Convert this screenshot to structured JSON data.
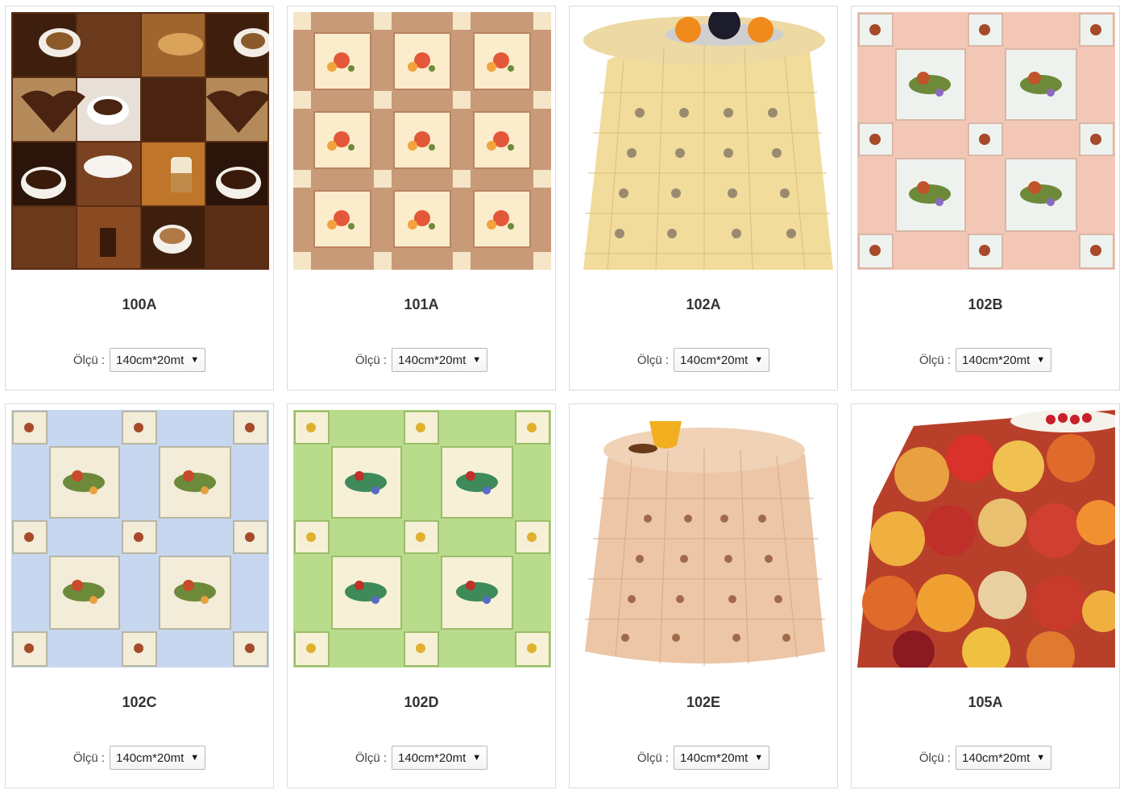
{
  "products": [
    {
      "code": "100A",
      "size_label": "Ölçü :",
      "size_value": "140cm*20mt",
      "pattern": "coffee-collage"
    },
    {
      "code": "101A",
      "size_label": "Ölçü :",
      "size_value": "140cm*20mt",
      "pattern": "floral-beige-grid"
    },
    {
      "code": "102A",
      "size_label": "Ölçü :",
      "size_value": "140cm*20mt",
      "pattern": "round-table-yellow"
    },
    {
      "code": "102B",
      "size_label": "Ölçü :",
      "size_value": "140cm*20mt",
      "pattern": "floral-pink-grid"
    },
    {
      "code": "102C",
      "size_label": "Ölçü :",
      "size_value": "140cm*20mt",
      "pattern": "floral-blue-grid"
    },
    {
      "code": "102D",
      "size_label": "Ölçü :",
      "size_value": "140cm*20mt",
      "pattern": "floral-green-grid"
    },
    {
      "code": "102E",
      "size_label": "Ölçü :",
      "size_value": "140cm*20mt",
      "pattern": "round-table-peach"
    },
    {
      "code": "105A",
      "size_label": "Ölçü :",
      "size_value": "140cm*20mt",
      "pattern": "fruit-tablecloth"
    }
  ],
  "icons": {
    "select_caret": "caret-down-icon"
  }
}
